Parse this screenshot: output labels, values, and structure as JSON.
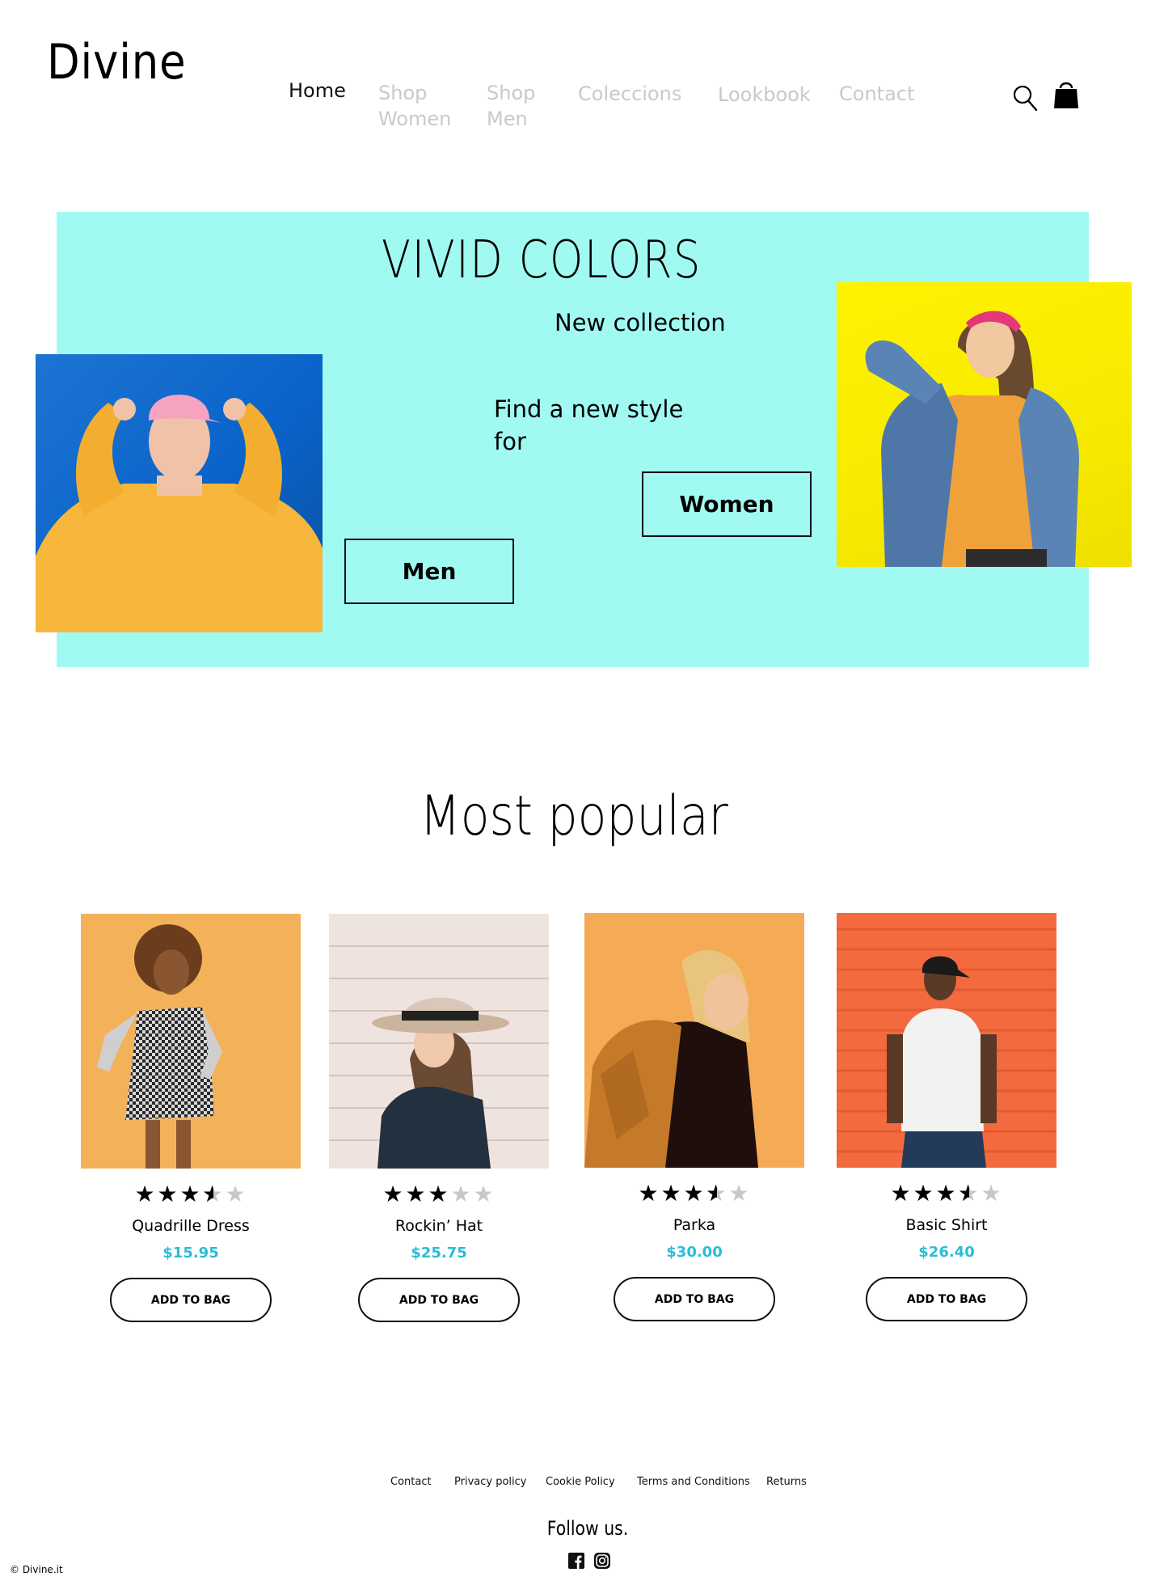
{
  "brand": {
    "logo": "Divine"
  },
  "nav": {
    "items": [
      {
        "label": "Home",
        "active": true
      },
      {
        "label": "Shop Women",
        "active": false
      },
      {
        "label": "Shop Men",
        "active": false
      },
      {
        "label": "Coleccions",
        "active": false
      },
      {
        "label": "Lookbook",
        "active": false
      },
      {
        "label": "Contact",
        "active": false
      }
    ],
    "icons": [
      "search-icon",
      "cart-icon"
    ]
  },
  "hero": {
    "title": "VIVID COLORS",
    "subtitle": "New collection",
    "tagline": "Find a new style for",
    "buttons": {
      "women": "Women",
      "men": "Men"
    },
    "background_color": "#a1faf1"
  },
  "popular": {
    "title": "Most popular",
    "button_label": "ADD TO BAG",
    "price_color": "#2bbcd6",
    "products": [
      {
        "name": "Quadrille Dress",
        "price": "$15.95",
        "rating": 3.5
      },
      {
        "name": "Rockin’ Hat",
        "price": "$25.75",
        "rating": 3
      },
      {
        "name": "Parka",
        "price": "$30.00",
        "rating": 3.5
      },
      {
        "name": "Basic Shirt",
        "price": "$26.40",
        "rating": 3.5
      }
    ]
  },
  "footer": {
    "links": [
      "Contact",
      "Privacy policy",
      "Cookie Policy",
      "Terms and Conditions",
      "Returns"
    ],
    "follow": "Follow us.",
    "social": [
      "facebook-icon",
      "instagram-icon"
    ],
    "copyright": "© Divine.it"
  }
}
